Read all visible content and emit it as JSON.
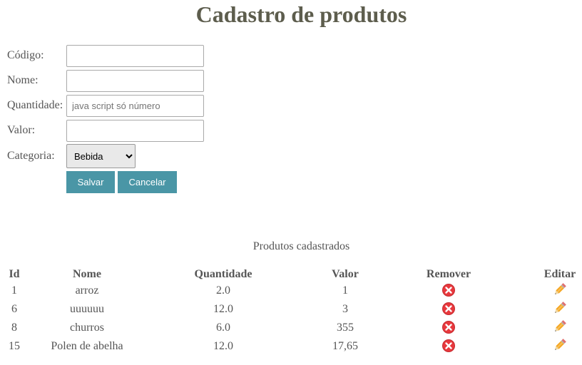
{
  "page": {
    "title": "Cadastro de produtos"
  },
  "form": {
    "codigo_label": "Código:",
    "codigo_value": "",
    "nome_label": "Nome:",
    "nome_value": "",
    "quantidade_label": "Quantidade:",
    "quantidade_value": "",
    "quantidade_placeholder": "java script só número",
    "valor_label": "Valor:",
    "valor_value": "",
    "categoria_label": "Categoria:",
    "categoria_selected": "Bebida",
    "save_label": "Salvar",
    "cancel_label": "Cancelar"
  },
  "table": {
    "caption": "Produtos cadastrados",
    "headers": {
      "id": "Id",
      "nome": "Nome",
      "quantidade": "Quantidade",
      "valor": "Valor",
      "remover": "Remover",
      "editar": "Editar"
    },
    "rows": [
      {
        "id": "1",
        "nome": "arroz",
        "quantidade": "2.0",
        "valor": "1"
      },
      {
        "id": "6",
        "nome": "uuuuuu",
        "quantidade": "12.0",
        "valor": "3"
      },
      {
        "id": "8",
        "nome": "churros",
        "quantidade": "6.0",
        "valor": "355"
      },
      {
        "id": "15",
        "nome": "Polen de abelha",
        "quantidade": "12.0",
        "valor": "17,65"
      }
    ],
    "remove_icon": "remove-icon",
    "edit_icon": "pencil-icon"
  },
  "colors": {
    "button_bg": "#4a96a6",
    "remove_red": "#e8383d",
    "title": "#5d5d4d"
  }
}
